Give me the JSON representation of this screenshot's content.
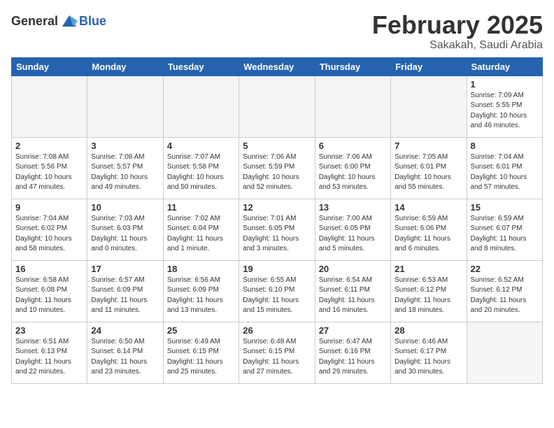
{
  "header": {
    "logo_general": "General",
    "logo_blue": "Blue",
    "month_title": "February 2025",
    "location": "Sakakah, Saudi Arabia"
  },
  "weekdays": [
    "Sunday",
    "Monday",
    "Tuesday",
    "Wednesday",
    "Thursday",
    "Friday",
    "Saturday"
  ],
  "weeks": [
    [
      {
        "day": "",
        "info": ""
      },
      {
        "day": "",
        "info": ""
      },
      {
        "day": "",
        "info": ""
      },
      {
        "day": "",
        "info": ""
      },
      {
        "day": "",
        "info": ""
      },
      {
        "day": "",
        "info": ""
      },
      {
        "day": "1",
        "info": "Sunrise: 7:09 AM\nSunset: 5:55 PM\nDaylight: 10 hours and 46 minutes."
      }
    ],
    [
      {
        "day": "2",
        "info": "Sunrise: 7:08 AM\nSunset: 5:56 PM\nDaylight: 10 hours and 47 minutes."
      },
      {
        "day": "3",
        "info": "Sunrise: 7:08 AM\nSunset: 5:57 PM\nDaylight: 10 hours and 49 minutes."
      },
      {
        "day": "4",
        "info": "Sunrise: 7:07 AM\nSunset: 5:58 PM\nDaylight: 10 hours and 50 minutes."
      },
      {
        "day": "5",
        "info": "Sunrise: 7:06 AM\nSunset: 5:59 PM\nDaylight: 10 hours and 52 minutes."
      },
      {
        "day": "6",
        "info": "Sunrise: 7:06 AM\nSunset: 6:00 PM\nDaylight: 10 hours and 53 minutes."
      },
      {
        "day": "7",
        "info": "Sunrise: 7:05 AM\nSunset: 6:01 PM\nDaylight: 10 hours and 55 minutes."
      },
      {
        "day": "8",
        "info": "Sunrise: 7:04 AM\nSunset: 6:01 PM\nDaylight: 10 hours and 57 minutes."
      }
    ],
    [
      {
        "day": "9",
        "info": "Sunrise: 7:04 AM\nSunset: 6:02 PM\nDaylight: 10 hours and 58 minutes."
      },
      {
        "day": "10",
        "info": "Sunrise: 7:03 AM\nSunset: 6:03 PM\nDaylight: 11 hours and 0 minutes."
      },
      {
        "day": "11",
        "info": "Sunrise: 7:02 AM\nSunset: 6:04 PM\nDaylight: 11 hours and 1 minute."
      },
      {
        "day": "12",
        "info": "Sunrise: 7:01 AM\nSunset: 6:05 PM\nDaylight: 11 hours and 3 minutes."
      },
      {
        "day": "13",
        "info": "Sunrise: 7:00 AM\nSunset: 6:05 PM\nDaylight: 11 hours and 5 minutes."
      },
      {
        "day": "14",
        "info": "Sunrise: 6:59 AM\nSunset: 6:06 PM\nDaylight: 11 hours and 6 minutes."
      },
      {
        "day": "15",
        "info": "Sunrise: 6:59 AM\nSunset: 6:07 PM\nDaylight: 11 hours and 8 minutes."
      }
    ],
    [
      {
        "day": "16",
        "info": "Sunrise: 6:58 AM\nSunset: 6:08 PM\nDaylight: 11 hours and 10 minutes."
      },
      {
        "day": "17",
        "info": "Sunrise: 6:57 AM\nSunset: 6:09 PM\nDaylight: 11 hours and 11 minutes."
      },
      {
        "day": "18",
        "info": "Sunrise: 6:56 AM\nSunset: 6:09 PM\nDaylight: 11 hours and 13 minutes."
      },
      {
        "day": "19",
        "info": "Sunrise: 6:55 AM\nSunset: 6:10 PM\nDaylight: 11 hours and 15 minutes."
      },
      {
        "day": "20",
        "info": "Sunrise: 6:54 AM\nSunset: 6:11 PM\nDaylight: 11 hours and 16 minutes."
      },
      {
        "day": "21",
        "info": "Sunrise: 6:53 AM\nSunset: 6:12 PM\nDaylight: 11 hours and 18 minutes."
      },
      {
        "day": "22",
        "info": "Sunrise: 6:52 AM\nSunset: 6:12 PM\nDaylight: 11 hours and 20 minutes."
      }
    ],
    [
      {
        "day": "23",
        "info": "Sunrise: 6:51 AM\nSunset: 6:13 PM\nDaylight: 11 hours and 22 minutes."
      },
      {
        "day": "24",
        "info": "Sunrise: 6:50 AM\nSunset: 6:14 PM\nDaylight: 11 hours and 23 minutes."
      },
      {
        "day": "25",
        "info": "Sunrise: 6:49 AM\nSunset: 6:15 PM\nDaylight: 11 hours and 25 minutes."
      },
      {
        "day": "26",
        "info": "Sunrise: 6:48 AM\nSunset: 6:15 PM\nDaylight: 11 hours and 27 minutes."
      },
      {
        "day": "27",
        "info": "Sunrise: 6:47 AM\nSunset: 6:16 PM\nDaylight: 11 hours and 29 minutes."
      },
      {
        "day": "28",
        "info": "Sunrise: 6:46 AM\nSunset: 6:17 PM\nDaylight: 11 hours and 30 minutes."
      },
      {
        "day": "",
        "info": ""
      }
    ]
  ]
}
